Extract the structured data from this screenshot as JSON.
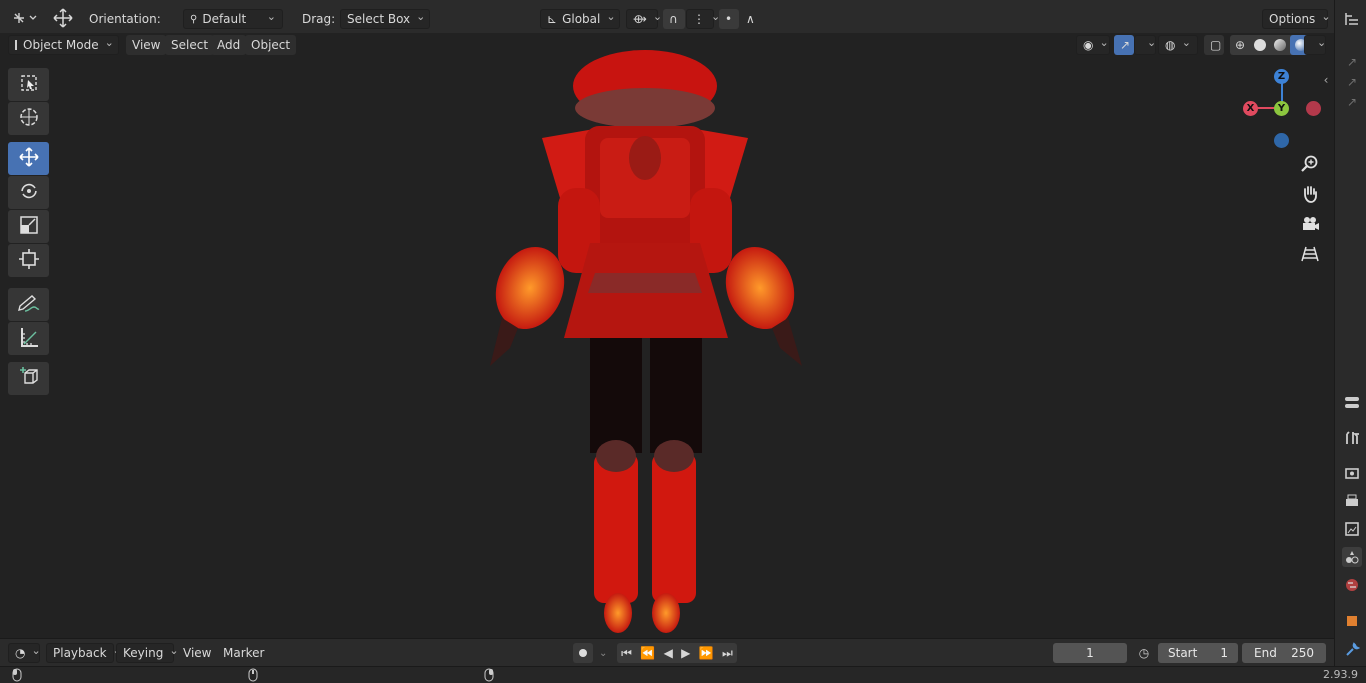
{
  "header": {
    "orientation_label": "Orientation:",
    "orientation_value": "Default",
    "drag_label": "Drag:",
    "drag_value": "Select Box",
    "transform_orientation": "Global",
    "options_label": "Options"
  },
  "viewport_header": {
    "mode": "Object Mode",
    "menus": [
      "View",
      "Select",
      "Add",
      "Object"
    ]
  },
  "gizmo": {
    "z": "Z",
    "y": "Y",
    "x": "X"
  },
  "timeline": {
    "menus": [
      "Playback",
      "Keying",
      "View",
      "Marker"
    ],
    "current_frame": "1",
    "start_label": "Start",
    "start_value": "1",
    "end_label": "End",
    "end_value": "250"
  },
  "status": {
    "version": "2.93.9"
  },
  "colors": {
    "accent": "#4772b3",
    "axis_x": "#e04a5f",
    "axis_y": "#8cc63f",
    "axis_z": "#3d82d6",
    "model": "#d01a12"
  },
  "icons": {
    "toolbar": [
      "select-box-icon",
      "cursor-icon",
      "move-icon",
      "rotate-icon",
      "scale-icon",
      "transform-icon",
      "annotate-icon",
      "measure-icon",
      "add-cube-icon"
    ],
    "navigation": [
      "zoom-icon",
      "hand-pan-icon",
      "camera-icon",
      "grid-icon"
    ],
    "properties": [
      "tool-icon",
      "render-icon",
      "output-icon",
      "view-layer-icon",
      "scene-icon",
      "world-icon",
      "object-icon",
      "wrench-icon"
    ]
  }
}
